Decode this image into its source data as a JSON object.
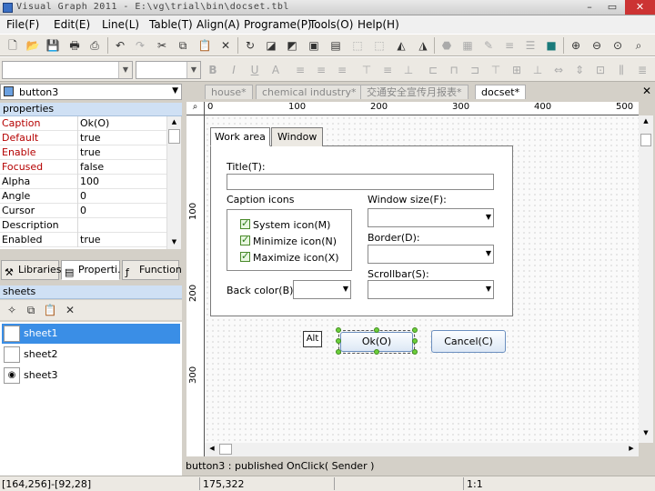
{
  "window": {
    "title": "Visual Graph 2011 - E:\\vg\\trial\\bin\\docset.tbl",
    "min_icon": "minimize-icon",
    "max_icon": "maximize-icon",
    "close_icon": "close-icon",
    "min_glyph": "–",
    "max_glyph": "▭",
    "close_glyph": "✕"
  },
  "menu": [
    "File(F)",
    "Edit(E)",
    "Line(L)",
    "Table(T)",
    "Align(A)",
    "Programe(P)",
    "Tools(O)",
    "Help(H)"
  ],
  "object_selector": {
    "value": "button3"
  },
  "properties": {
    "header": "properties",
    "rows": [
      {
        "key": "Caption",
        "value": "Ok(O)",
        "highlight": true
      },
      {
        "key": "Default",
        "value": "true",
        "highlight": true
      },
      {
        "key": "Enable",
        "value": "true",
        "highlight": true
      },
      {
        "key": "Focused",
        "value": "false",
        "highlight": true
      },
      {
        "key": "Alpha",
        "value": "100",
        "highlight": false
      },
      {
        "key": "Angle",
        "value": "0",
        "highlight": false
      },
      {
        "key": "Cursor",
        "value": "0",
        "highlight": false
      },
      {
        "key": "Description",
        "value": "",
        "highlight": false
      },
      {
        "key": "Enabled",
        "value": "true",
        "highlight": false
      }
    ]
  },
  "panel_tabs": [
    "Libraries",
    "Properti.",
    "Function"
  ],
  "sheets": {
    "header": "sheets",
    "items": [
      "sheet1",
      "sheet2",
      "sheet3"
    ],
    "selected": "sheet1"
  },
  "doc_tabs": [
    "house*",
    "chemical industry*",
    "交通安全宣传月报表*",
    "docset*"
  ],
  "active_doc_tab": "docset*",
  "ruler": {
    "top_labels": [
      "0",
      "100",
      "200",
      "300",
      "400",
      "500"
    ],
    "left_labels": [
      "100",
      "200",
      "300"
    ]
  },
  "dialog": {
    "tabs": [
      "Work area",
      "Window"
    ],
    "title_label": "Title(T):",
    "title_value": "",
    "caption_icons_label": "Caption icons",
    "checkboxes": [
      "System icon(M)",
      "Minimize icon(N)",
      "Maximize icon(X)"
    ],
    "back_color_label": "Back color(B):",
    "window_size_label": "Window size(F):",
    "border_label": "Border(D):",
    "scrollbar_label": "Scrollbar(S):"
  },
  "buttons": {
    "alt_label": "Alt",
    "ok_label": "Ok(O)",
    "cancel_label": "Cancel(C)"
  },
  "event_hint": "button3 : published OnClick( Sender )",
  "status": {
    "cell1": "[164,256]-[92,28]",
    "cell2": "175,322",
    "cell3": "1:1"
  },
  "colors": {
    "accent": "#3a8ee6",
    "handle": "#6ccf3a",
    "property_highlight": "#b50000"
  }
}
